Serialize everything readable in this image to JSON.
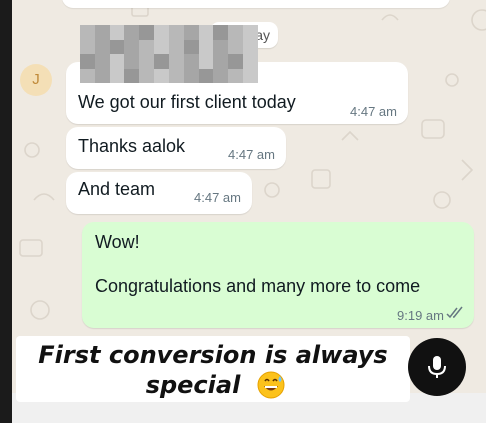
{
  "chat": {
    "avatar_initial": "J",
    "day_chip_partial": "lay",
    "messages": [
      {
        "direction": "incoming",
        "text": "We got our first client today",
        "time": "4:47 am"
      },
      {
        "direction": "incoming",
        "text": "Thanks aalok",
        "time": "4:47 am"
      },
      {
        "direction": "incoming",
        "text": "And team",
        "time": "4:47 am"
      },
      {
        "direction": "outgoing",
        "line1": "Wow!",
        "line2": "Congratulations and many more to come",
        "time": "9:19 am",
        "status": "read"
      }
    ]
  },
  "overlay": {
    "caption_line1": "First conversion is always",
    "caption_line2": "special",
    "caption_emoji": "grinning-sweat-emoji"
  },
  "colors": {
    "chat_background": "#efeae2",
    "incoming_bubble": "#ffffff",
    "outgoing_bubble": "#d9fdd3",
    "mic_button": "#111111"
  },
  "icons": {
    "mic": "mic-icon",
    "read_receipt": "double-check-icon"
  }
}
